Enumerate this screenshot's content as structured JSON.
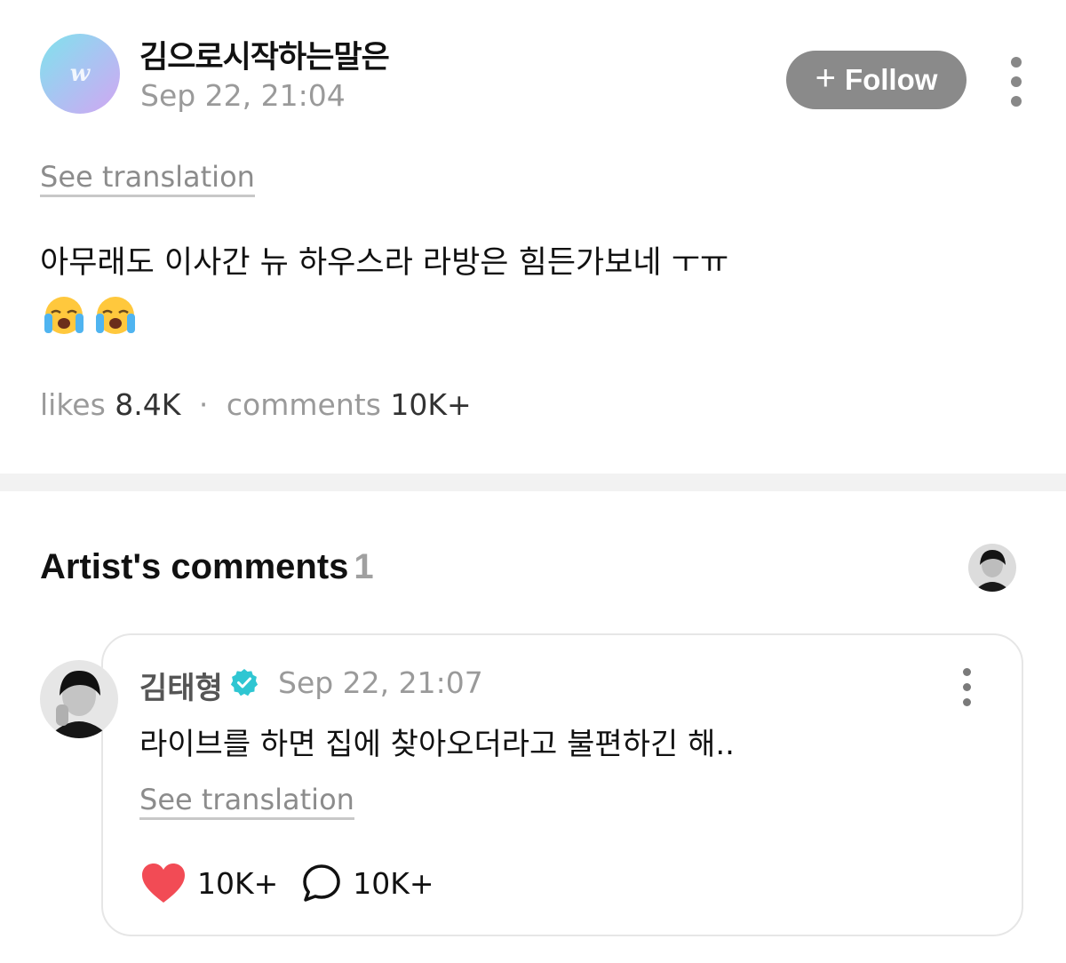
{
  "post": {
    "author": "김으로시작하는말은",
    "avatar_letter": "w",
    "date": "Sep 22, 21:04",
    "follow_label": "Follow",
    "see_translation": "See translation",
    "body": "아무래도 이사간 뉴 하우스라 라방은 힘든가보네 ㅜㅠ",
    "emojis": [
      "loudly-crying-face",
      "loudly-crying-face"
    ],
    "likes_label": "likes",
    "likes_count": "8.4K",
    "comments_label": "comments",
    "comments_count": "10K+"
  },
  "artist_comments": {
    "title": "Artist's comments",
    "count": "1",
    "comment": {
      "author": "김태형",
      "verified": true,
      "date": "Sep 22, 21:07",
      "text": "라이브를 하면 집에 찾아오더라고 불편하긴 해..",
      "see_translation": "See translation",
      "likes": "10K+",
      "replies": "10K+"
    }
  },
  "colors": {
    "follow_bg": "#8a8a8a",
    "heart": "#f24b55",
    "verified_badge": "#2fc6d2",
    "avatar_gradient_start": "#7fe3ec",
    "avatar_gradient_end": "#d2a6f2"
  }
}
